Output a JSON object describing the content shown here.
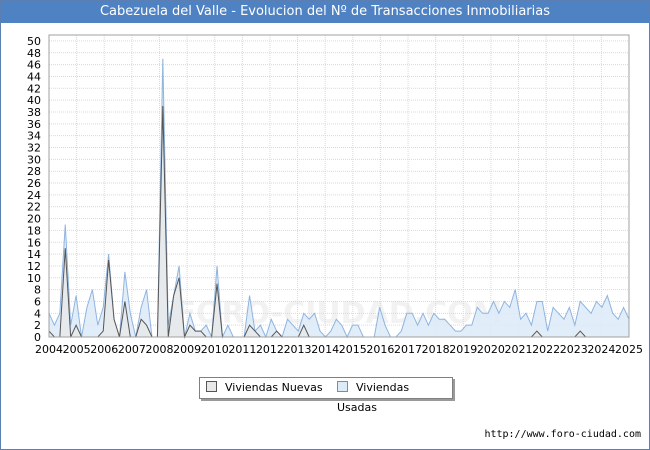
{
  "title": "Cabezuela del Valle - Evolucion del Nº de Transacciones Inmobiliarias",
  "source": "http://www.foro-ciudad.com",
  "watermark": "FORO-CIUDAD.COM",
  "colors": {
    "title_bar": "#4f82c3",
    "nuevas_line": "#555555",
    "nuevas_fill": "#e8e8e8",
    "usadas_line": "#8fb4df",
    "usadas_fill": "#dcebf8"
  },
  "chart_data": {
    "type": "area",
    "title": "Cabezuela del Valle - Evolucion del Nº de Transacciones Inmobiliarias",
    "xlabel": "",
    "ylabel": "",
    "x_start": 2004,
    "x_end": 2025,
    "ylim": [
      0,
      51
    ],
    "yticks": [
      0,
      2,
      4,
      6,
      8,
      10,
      12,
      14,
      16,
      18,
      20,
      22,
      24,
      26,
      28,
      30,
      32,
      34,
      36,
      38,
      40,
      42,
      44,
      46,
      48,
      50
    ],
    "xticks": [
      "2004",
      "2005",
      "2006",
      "2007",
      "2008",
      "2009",
      "2010",
      "2011",
      "2012",
      "2013",
      "2014",
      "2015",
      "2016",
      "2017",
      "2018",
      "2019",
      "2020",
      "2021",
      "2022",
      "2023",
      "2024",
      "2025"
    ],
    "grid": true,
    "legend_position": "bottom-center",
    "series": [
      {
        "name": "Viviendas Nuevas",
        "values": [
          1,
          0,
          0,
          15,
          0,
          2,
          0,
          0,
          0,
          0,
          1,
          13,
          3,
          0,
          6,
          0,
          0,
          3,
          2,
          0,
          0,
          39,
          0,
          7,
          10,
          0,
          2,
          1,
          1,
          0,
          0,
          9,
          0,
          0,
          0,
          0,
          0,
          2,
          1,
          0,
          0,
          0,
          1,
          0,
          0,
          0,
          0,
          2,
          0,
          0,
          0,
          0,
          0,
          0,
          0,
          0,
          0,
          0,
          0,
          0,
          0,
          0,
          0,
          0,
          0,
          0,
          0,
          0,
          0,
          0,
          0,
          0,
          0,
          0,
          0,
          0,
          0,
          0,
          0,
          0,
          0,
          0,
          0,
          0,
          0,
          0,
          0,
          0,
          0,
          0,
          1,
          0,
          0,
          0,
          0,
          0,
          0,
          0,
          1,
          0,
          0,
          0,
          0,
          0,
          0,
          0,
          0,
          0
        ]
      },
      {
        "name": "Viviendas Usadas",
        "values": [
          4,
          2,
          4,
          19,
          2,
          7,
          0,
          5,
          8,
          2,
          5,
          14,
          3,
          0,
          11,
          4,
          0,
          5,
          8,
          0,
          0,
          47,
          2,
          7,
          12,
          0,
          4,
          1,
          1,
          2,
          0,
          12,
          0,
          2,
          0,
          0,
          0,
          7,
          1,
          2,
          0,
          3,
          1,
          0,
          3,
          2,
          1,
          4,
          3,
          4,
          1,
          0,
          1,
          3,
          2,
          0,
          2,
          2,
          0,
          0,
          0,
          5,
          2,
          0,
          0,
          1,
          4,
          4,
          2,
          4,
          2,
          4,
          3,
          3,
          2,
          1,
          1,
          2,
          2,
          5,
          4,
          4,
          6,
          4,
          6,
          5,
          8,
          3,
          4,
          2,
          6,
          6,
          1,
          5,
          4,
          3,
          5,
          2,
          6,
          5,
          4,
          6,
          5,
          7,
          4,
          3,
          5,
          3
        ]
      }
    ]
  }
}
